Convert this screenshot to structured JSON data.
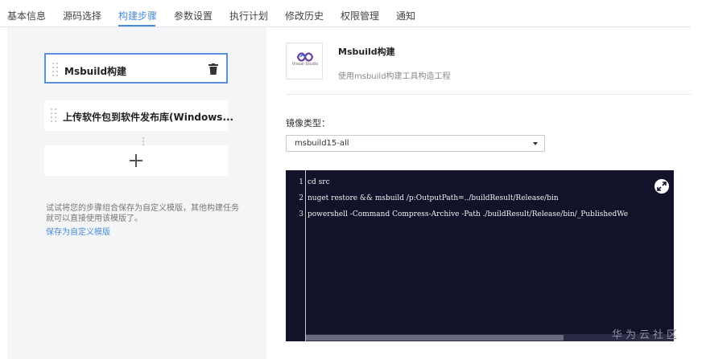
{
  "tabs": [
    {
      "label": "基本信息",
      "active": false
    },
    {
      "label": "源码选择",
      "active": false
    },
    {
      "label": "构建步骤",
      "active": true
    },
    {
      "label": "参数设置",
      "active": false
    },
    {
      "label": "执行计划",
      "active": false
    },
    {
      "label": "修改历史",
      "active": false
    },
    {
      "label": "权限管理",
      "active": false
    },
    {
      "label": "通知",
      "active": false
    }
  ],
  "steps": [
    {
      "label": "Msbuild构建",
      "selected": true,
      "icon": "trash-icon"
    },
    {
      "label": "上传软件包到软件发布库(Windows...",
      "selected": false
    }
  ],
  "add_step_icon": "plus-icon",
  "hint": {
    "text": "试试将您的步骤组合保存为自定义模版，其他构建任务就可以直接使用该模版了。",
    "link": "保存为自定义模版"
  },
  "plugin": {
    "logo_caption": "Visual Studio",
    "title": "Msbuild构建",
    "description": "使用msbuild构建工具构造工程"
  },
  "image_type": {
    "label": "镜像类型：",
    "value": "msbuild15-all"
  },
  "editor": {
    "lines": [
      {
        "no": "1",
        "code": "cd src"
      },
      {
        "no": "2",
        "code": "nuget restore && msbuild /p:OutputPath=../buildResult/Release/bin"
      },
      {
        "no": "3",
        "code": "powershell -Command Compress-Archive -Path ./buildResult/Release/bin/_PublishedWe"
      }
    ],
    "expand_icon": "expand-icon"
  },
  "watermark": "华为云社区",
  "colors": {
    "accent": "#4a8bd8",
    "editor_bg": "#13122b",
    "panel_bg": "#f4f5f7"
  }
}
